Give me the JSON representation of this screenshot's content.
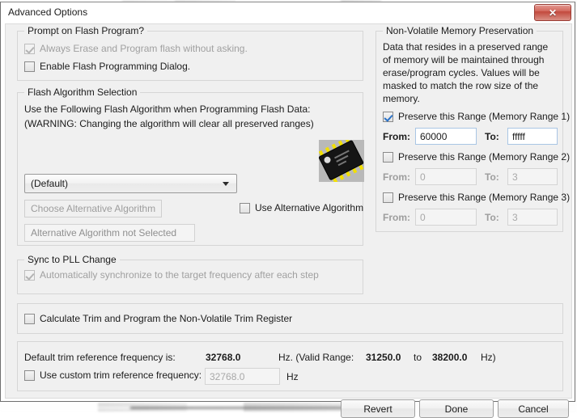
{
  "window": {
    "title": "Advanced Options",
    "close_label": "✕",
    "close_icon": "close-icon"
  },
  "prompt_group": {
    "legend": "Prompt on Flash Program?",
    "items": [
      {
        "label": "Always Erase and Program flash without asking.",
        "checked": true,
        "enabled": false
      },
      {
        "label": "Enable Flash Programming Dialog.",
        "checked": false,
        "enabled": true
      }
    ]
  },
  "flash_algorithm": {
    "legend": "Flash Algorithm Selection",
    "line1": "Use the Following Flash Algorithm when Programming Flash Data:",
    "line2": "(WARNING: Changing the algorithm will clear all preserved ranges)",
    "combo_value": "(Default)",
    "choose_button": "Choose Alternative Algorithm",
    "status_button": "Alternative Algorithm not Selected",
    "use_alt_label": "Use Alternative Algorithm",
    "use_alt_checked": false,
    "chip_icon": "ic-chip-icon"
  },
  "memory_preservation": {
    "legend": "Non-Volatile Memory Preservation",
    "description": "Data that resides in a preserved range of memory will be maintained through erase/program cycles. Values will be masked to match the row size of the memory.",
    "description_lines": [
      "Data that resides in a preserved range",
      "of memory will be maintained through",
      "erase/program cycles. Values will be",
      "masked to match the row size of the",
      "memory."
    ],
    "from_label": "From:",
    "to_label": "To:",
    "ranges": [
      {
        "label": "Preserve this Range (Memory Range 1)",
        "checked": true,
        "enabled": true,
        "from": "60000",
        "to": "fffff"
      },
      {
        "label": "Preserve this Range (Memory Range 2)",
        "checked": false,
        "enabled": false,
        "from": "0",
        "to": "3"
      },
      {
        "label": "Preserve this Range (Memory Range 3)",
        "checked": false,
        "enabled": false,
        "from": "0",
        "to": "3"
      }
    ]
  },
  "sync_pll": {
    "legend": "Sync to PLL Change",
    "label": "Automatically synchronize to the target frequency after each step",
    "checked": true,
    "enabled": false
  },
  "trim_register": {
    "label": "Calculate Trim and Program the Non-Volatile Trim Register",
    "checked": false
  },
  "trim_frequency": {
    "default_label": "Default trim reference frequency is:",
    "default_value": "32768.0",
    "unit_prefix": "Hz. (Valid Range:",
    "range_min": "31250.0",
    "range_to": "to",
    "range_max": "38200.0",
    "unit_suffix": "Hz)",
    "custom_label": "Use custom trim reference frequency:",
    "custom_checked": false,
    "custom_value": "32768.0",
    "custom_unit": "Hz"
  },
  "footer": {
    "revert": "Revert",
    "done": "Done",
    "cancel": "Cancel"
  }
}
